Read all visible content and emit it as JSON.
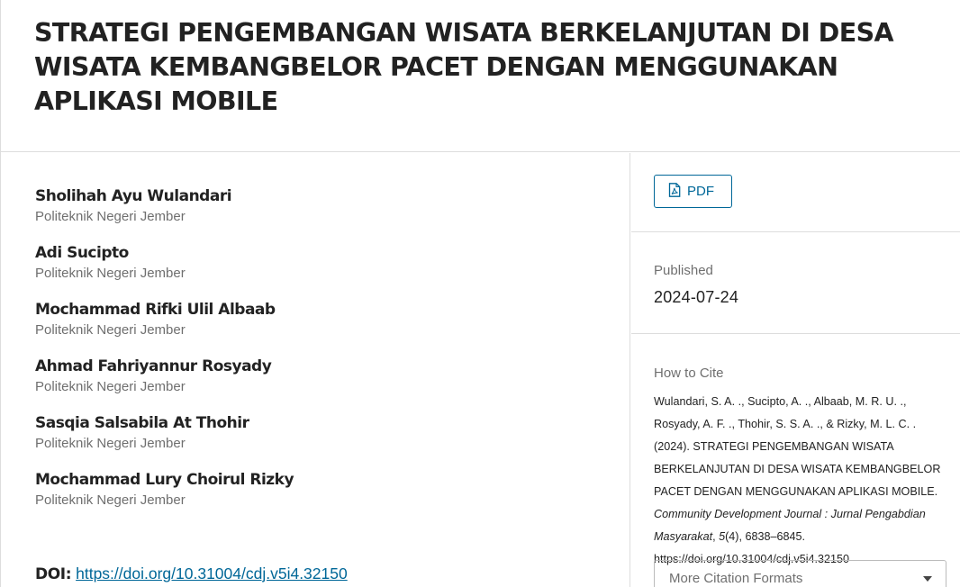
{
  "article": {
    "title": "STRATEGI PENGEMBANGAN WISATA BERKELANJUTAN DI DESA WISATA KEMBANGBELOR PACET DENGAN MENGGUNAKAN APLIKASI MOBILE"
  },
  "authors": [
    {
      "name": "Sholihah Ayu Wulandari",
      "affiliation": "Politeknik Negeri Jember"
    },
    {
      "name": "Adi Sucipto",
      "affiliation": "Politeknik Negeri Jember"
    },
    {
      "name": "Mochammad Rifki Ulil Albaab",
      "affiliation": "Politeknik Negeri Jember"
    },
    {
      "name": "Ahmad Fahriyannur Rosyady",
      "affiliation": "Politeknik Negeri Jember"
    },
    {
      "name": "Sasqia Salsabila At Thohir",
      "affiliation": "Politeknik Negeri Jember"
    },
    {
      "name": "Mochammad Lury Choirul Rizky",
      "affiliation": "Politeknik Negeri Jember"
    }
  ],
  "doi": {
    "label": "DOI:",
    "url": "https://doi.org/10.31004/cdj.v5i4.32150"
  },
  "sidebar": {
    "pdf_label": "PDF",
    "published_label": "Published",
    "published_date": "2024-07-24",
    "cite_label": "How to Cite",
    "citation": {
      "prefix": "Wulandari, S. A. ., Sucipto, A. ., Albaab, M. R. U. ., Rosyady, A. F. ., Thohir, S. S. A. ., & Rizky, M. L. C. . (2024). STRATEGI PENGEMBANGAN WISATA BERKELANJUTAN DI DESA WISATA KEMBANGBELOR PACET DENGAN MENGGUNAKAN APLIKASI MOBILE. ",
      "journal": "Community Development Journal : Jurnal Pengabdian Masyarakat",
      "sep1": ", ",
      "volume": "5",
      "issue_pages": "(4), 6838–6845. ",
      "doi": "https://doi.org/10.31004/cdj.v5i4.32150"
    },
    "more_formats_label": "More Citation Formats"
  },
  "colors": {
    "link": "#006798",
    "border": "#dddddd",
    "muted": "#6f6f6f",
    "text": "#222222"
  },
  "icons": {
    "pdf": "file-pdf-icon",
    "dropdown": "chevron-down-icon"
  }
}
